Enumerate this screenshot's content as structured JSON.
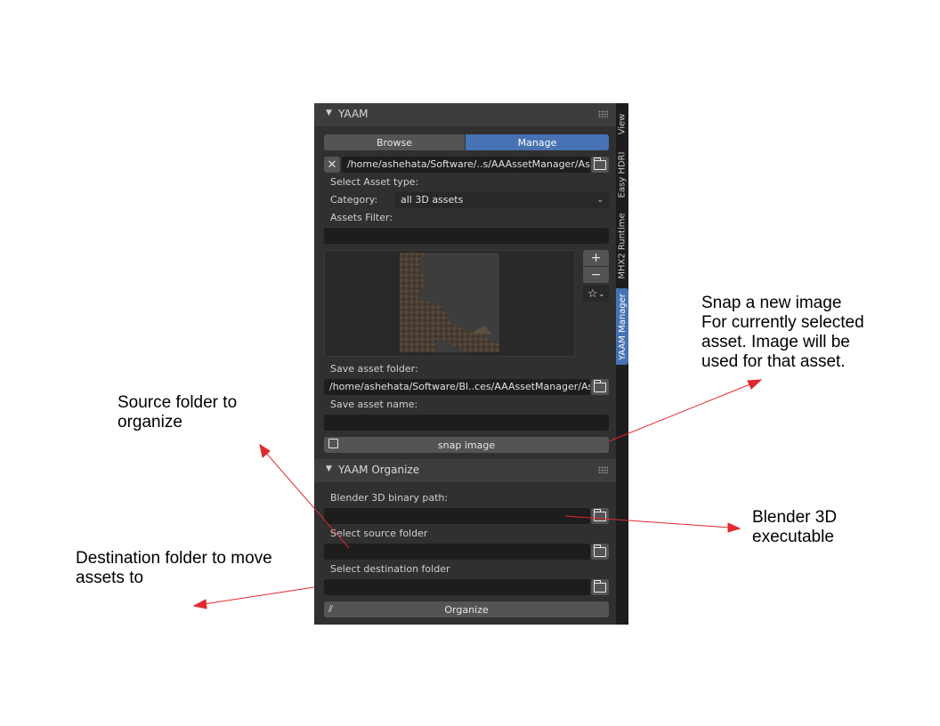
{
  "side_tabs": [
    {
      "label": "View"
    },
    {
      "label": "Easy HDRI"
    },
    {
      "label": "MHX2 Runtime"
    },
    {
      "label": "YAAM Manager",
      "active": true
    }
  ],
  "yaam_panel": {
    "title": "YAAM",
    "tabs": [
      {
        "label": "Browse",
        "active": false
      },
      {
        "label": "Manage",
        "active": true
      }
    ],
    "assets_path": "/home/ashehata/Software/..s/AAAssetManager/Assets/",
    "select_asset_type_label": "Select Asset type:",
    "category_label": "Category:",
    "category_value": "all 3D assets",
    "assets_filter_label": "Assets Filter:",
    "assets_filter_value": "",
    "plus_symbol": "+",
    "minus_symbol": "−",
    "save_asset_folder_label": "Save asset folder:",
    "save_asset_folder_value": "/home/ashehata/Software/Bl..ces/AAAssetManager/Assets/",
    "save_asset_name_label": "Save asset name:",
    "save_asset_name_value": "",
    "snap_button_label": "snap image"
  },
  "organize_panel": {
    "title": "YAAM Organize",
    "blender_path_label": "Blender 3D binary path:",
    "blender_path_value": "",
    "source_folder_label": "Select source folder",
    "source_folder_value": "",
    "destination_folder_label": "Select destination folder",
    "destination_folder_value": "",
    "organize_button_label": "Organize"
  },
  "annotations": {
    "snap": [
      "Snap a new image",
      "For currently selected",
      "asset. Image will be",
      "used for that asset."
    ],
    "source": [
      "Source folder to",
      "organize"
    ],
    "destination": [
      "Destination folder to move",
      "assets to"
    ],
    "blender": [
      "Blender 3D",
      "executable"
    ]
  },
  "colors": {
    "panel_bg": "#303030",
    "header_bg": "#3d3d3d",
    "field_bg": "#1d1d1d",
    "button_bg": "#545454",
    "accent": "#4772b3",
    "arrow": "#e0282e"
  }
}
